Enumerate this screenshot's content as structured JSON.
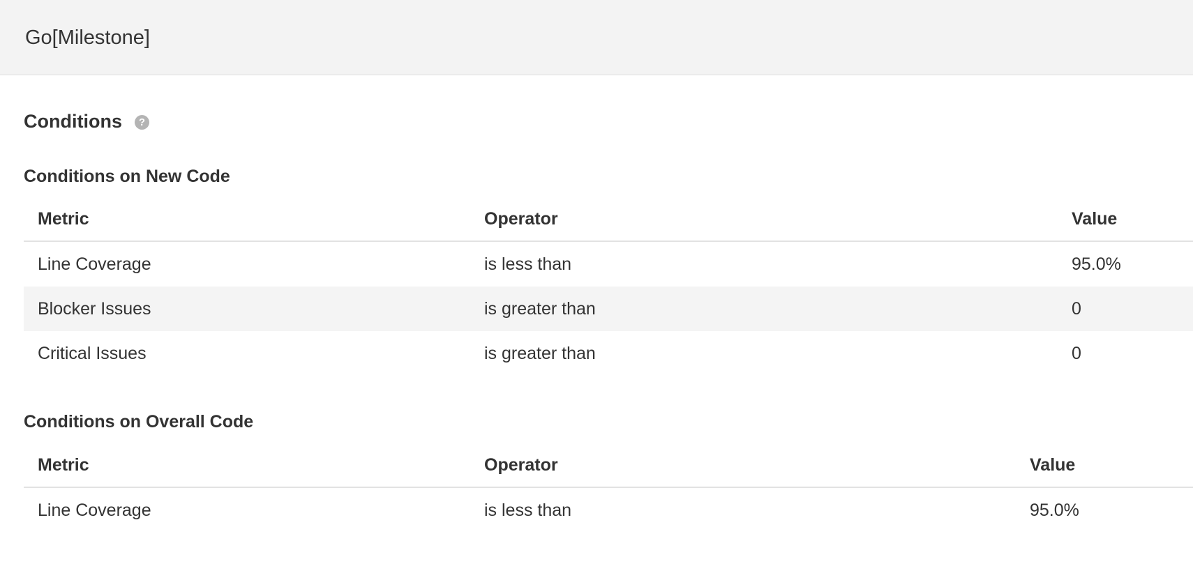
{
  "header": {
    "title": "Go[Milestone]"
  },
  "conditions": {
    "title": "Conditions",
    "help_icon": "question-mark-circle-icon"
  },
  "new_code": {
    "title": "Conditions on New Code",
    "columns": [
      "Metric",
      "Operator",
      "Value"
    ],
    "rows": [
      {
        "metric": "Line Coverage",
        "operator": "is less than",
        "value": "95.0%"
      },
      {
        "metric": "Blocker Issues",
        "operator": "is greater than",
        "value": "0"
      },
      {
        "metric": "Critical Issues",
        "operator": "is greater than",
        "value": "0"
      }
    ]
  },
  "overall_code": {
    "title": "Conditions on Overall Code",
    "columns": [
      "Metric",
      "Operator",
      "Value"
    ],
    "rows": [
      {
        "metric": "Line Coverage",
        "operator": "is less than",
        "value": "95.0%"
      }
    ]
  },
  "colors": {
    "header_bg": "#f3f3f3",
    "stripe_bg": "#f4f4f4",
    "text": "#333333",
    "help_icon": "#b4b4b4"
  }
}
